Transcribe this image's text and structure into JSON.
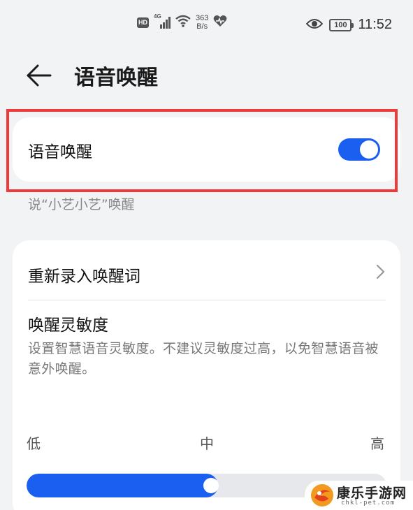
{
  "status_bar": {
    "hd": "HD",
    "network_gen": "4G",
    "speed_value": "363",
    "speed_unit": "B/s",
    "battery": "100",
    "time": "11:52"
  },
  "header": {
    "title": "语音唤醒"
  },
  "voice_wake": {
    "label": "语音唤醒",
    "enabled": true,
    "caption": "说“小艺小艺”唤醒"
  },
  "settings": {
    "rerecord_label": "重新录入唤醒词",
    "sensitivity_title": "唤醒灵敏度",
    "sensitivity_desc": "设置智慧语音灵敏度。不建议灵敏度过高，以免智慧语音被意外唤醒。",
    "levels": {
      "low": "低",
      "mid": "中",
      "high": "高"
    },
    "slider_value_fraction": 0.5
  },
  "colors": {
    "accent": "#1a5ff0",
    "highlight_border": "#ee3a3a",
    "background": "#f1f3f5"
  },
  "icons": {
    "back": "back-arrow-icon",
    "chevron": "chevron-right-icon",
    "wifi": "wifi-icon",
    "signal": "signal-icon",
    "eye": "eye-icon",
    "heart": "heart-rate-icon"
  },
  "watermark": {
    "text": "康乐手游网",
    "sub": "chkl-pet.com"
  }
}
